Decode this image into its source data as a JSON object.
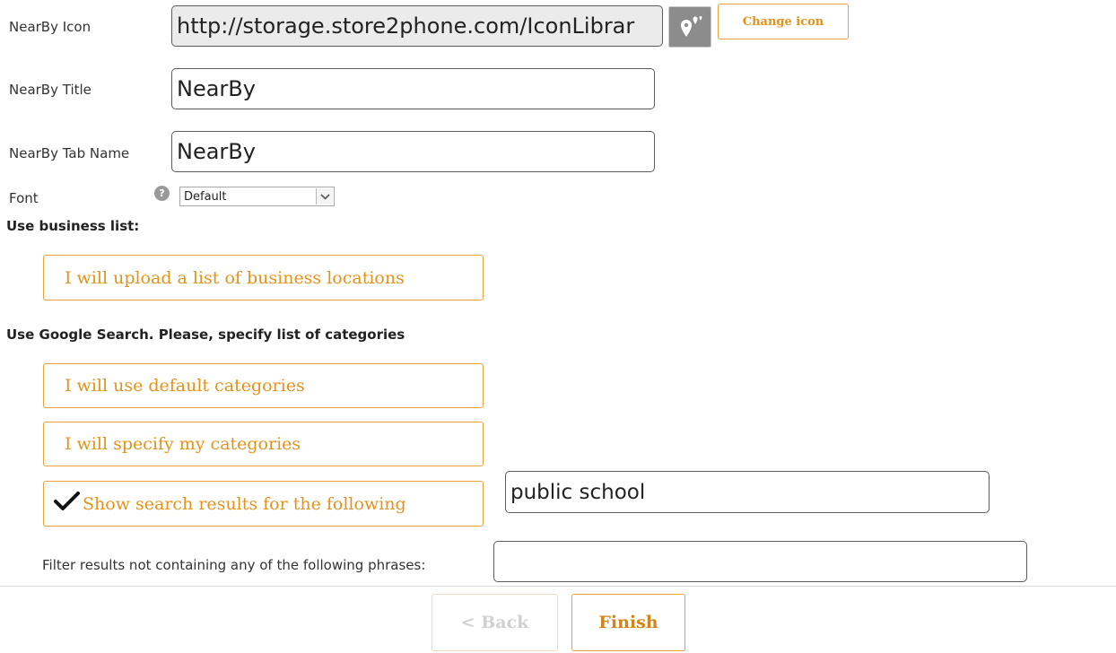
{
  "form": {
    "icon": {
      "label": "NearBy Icon",
      "value": "http://storage.store2phone.com/IconLibrar",
      "preview_icon": "map-pins-icon",
      "change_button": "Change icon"
    },
    "title": {
      "label": "NearBy Title",
      "value": "NearBy"
    },
    "tab_name": {
      "label": "NearBy Tab Name",
      "value": "NearBy"
    },
    "font": {
      "label": "Font",
      "help_icon": "help-icon",
      "help_glyph": "?",
      "selected": "Default",
      "arrow_icon": "chevron-down-icon"
    }
  },
  "business_section": {
    "title": "Use business list:",
    "upload_option": "I will upload a list of business locations"
  },
  "google_section": {
    "title": "Use Google Search. Please, specify list of categories",
    "default_option": "I will use default categories",
    "specify_option": "I will specify my categories",
    "show_results_option": "Show search results for the following",
    "check_icon": "checkmark-icon",
    "search_value": "public school",
    "filter_label": "Filter results not containing any of the following phrases:",
    "filter_value": ""
  },
  "footer": {
    "back_label": "< Back",
    "finish_label": "Finish"
  },
  "colors": {
    "accent": "#e5921a",
    "accent_border": "#e9a23b",
    "disabled_text": "#d0d0d0"
  }
}
